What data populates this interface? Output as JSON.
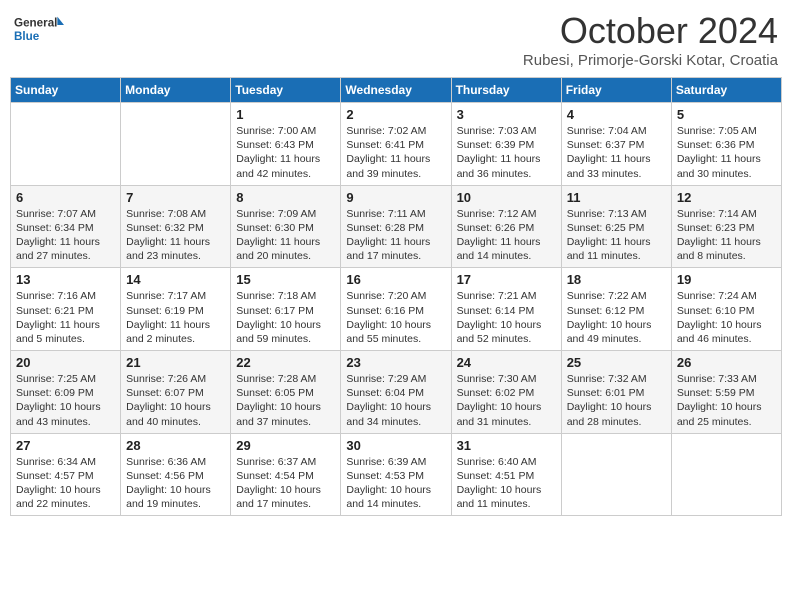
{
  "header": {
    "logo_line1": "General",
    "logo_line2": "Blue",
    "month_title": "October 2024",
    "subtitle": "Rubesi, Primorje-Gorski Kotar, Croatia"
  },
  "weekdays": [
    "Sunday",
    "Monday",
    "Tuesday",
    "Wednesday",
    "Thursday",
    "Friday",
    "Saturday"
  ],
  "weeks": [
    [
      {
        "day": "",
        "sunrise": "",
        "sunset": "",
        "daylight": ""
      },
      {
        "day": "",
        "sunrise": "",
        "sunset": "",
        "daylight": ""
      },
      {
        "day": "1",
        "sunrise": "Sunrise: 7:00 AM",
        "sunset": "Sunset: 6:43 PM",
        "daylight": "Daylight: 11 hours and 42 minutes."
      },
      {
        "day": "2",
        "sunrise": "Sunrise: 7:02 AM",
        "sunset": "Sunset: 6:41 PM",
        "daylight": "Daylight: 11 hours and 39 minutes."
      },
      {
        "day": "3",
        "sunrise": "Sunrise: 7:03 AM",
        "sunset": "Sunset: 6:39 PM",
        "daylight": "Daylight: 11 hours and 36 minutes."
      },
      {
        "day": "4",
        "sunrise": "Sunrise: 7:04 AM",
        "sunset": "Sunset: 6:37 PM",
        "daylight": "Daylight: 11 hours and 33 minutes."
      },
      {
        "day": "5",
        "sunrise": "Sunrise: 7:05 AM",
        "sunset": "Sunset: 6:36 PM",
        "daylight": "Daylight: 11 hours and 30 minutes."
      }
    ],
    [
      {
        "day": "6",
        "sunrise": "Sunrise: 7:07 AM",
        "sunset": "Sunset: 6:34 PM",
        "daylight": "Daylight: 11 hours and 27 minutes."
      },
      {
        "day": "7",
        "sunrise": "Sunrise: 7:08 AM",
        "sunset": "Sunset: 6:32 PM",
        "daylight": "Daylight: 11 hours and 23 minutes."
      },
      {
        "day": "8",
        "sunrise": "Sunrise: 7:09 AM",
        "sunset": "Sunset: 6:30 PM",
        "daylight": "Daylight: 11 hours and 20 minutes."
      },
      {
        "day": "9",
        "sunrise": "Sunrise: 7:11 AM",
        "sunset": "Sunset: 6:28 PM",
        "daylight": "Daylight: 11 hours and 17 minutes."
      },
      {
        "day": "10",
        "sunrise": "Sunrise: 7:12 AM",
        "sunset": "Sunset: 6:26 PM",
        "daylight": "Daylight: 11 hours and 14 minutes."
      },
      {
        "day": "11",
        "sunrise": "Sunrise: 7:13 AM",
        "sunset": "Sunset: 6:25 PM",
        "daylight": "Daylight: 11 hours and 11 minutes."
      },
      {
        "day": "12",
        "sunrise": "Sunrise: 7:14 AM",
        "sunset": "Sunset: 6:23 PM",
        "daylight": "Daylight: 11 hours and 8 minutes."
      }
    ],
    [
      {
        "day": "13",
        "sunrise": "Sunrise: 7:16 AM",
        "sunset": "Sunset: 6:21 PM",
        "daylight": "Daylight: 11 hours and 5 minutes."
      },
      {
        "day": "14",
        "sunrise": "Sunrise: 7:17 AM",
        "sunset": "Sunset: 6:19 PM",
        "daylight": "Daylight: 11 hours and 2 minutes."
      },
      {
        "day": "15",
        "sunrise": "Sunrise: 7:18 AM",
        "sunset": "Sunset: 6:17 PM",
        "daylight": "Daylight: 10 hours and 59 minutes."
      },
      {
        "day": "16",
        "sunrise": "Sunrise: 7:20 AM",
        "sunset": "Sunset: 6:16 PM",
        "daylight": "Daylight: 10 hours and 55 minutes."
      },
      {
        "day": "17",
        "sunrise": "Sunrise: 7:21 AM",
        "sunset": "Sunset: 6:14 PM",
        "daylight": "Daylight: 10 hours and 52 minutes."
      },
      {
        "day": "18",
        "sunrise": "Sunrise: 7:22 AM",
        "sunset": "Sunset: 6:12 PM",
        "daylight": "Daylight: 10 hours and 49 minutes."
      },
      {
        "day": "19",
        "sunrise": "Sunrise: 7:24 AM",
        "sunset": "Sunset: 6:10 PM",
        "daylight": "Daylight: 10 hours and 46 minutes."
      }
    ],
    [
      {
        "day": "20",
        "sunrise": "Sunrise: 7:25 AM",
        "sunset": "Sunset: 6:09 PM",
        "daylight": "Daylight: 10 hours and 43 minutes."
      },
      {
        "day": "21",
        "sunrise": "Sunrise: 7:26 AM",
        "sunset": "Sunset: 6:07 PM",
        "daylight": "Daylight: 10 hours and 40 minutes."
      },
      {
        "day": "22",
        "sunrise": "Sunrise: 7:28 AM",
        "sunset": "Sunset: 6:05 PM",
        "daylight": "Daylight: 10 hours and 37 minutes."
      },
      {
        "day": "23",
        "sunrise": "Sunrise: 7:29 AM",
        "sunset": "Sunset: 6:04 PM",
        "daylight": "Daylight: 10 hours and 34 minutes."
      },
      {
        "day": "24",
        "sunrise": "Sunrise: 7:30 AM",
        "sunset": "Sunset: 6:02 PM",
        "daylight": "Daylight: 10 hours and 31 minutes."
      },
      {
        "day": "25",
        "sunrise": "Sunrise: 7:32 AM",
        "sunset": "Sunset: 6:01 PM",
        "daylight": "Daylight: 10 hours and 28 minutes."
      },
      {
        "day": "26",
        "sunrise": "Sunrise: 7:33 AM",
        "sunset": "Sunset: 5:59 PM",
        "daylight": "Daylight: 10 hours and 25 minutes."
      }
    ],
    [
      {
        "day": "27",
        "sunrise": "Sunrise: 6:34 AM",
        "sunset": "Sunset: 4:57 PM",
        "daylight": "Daylight: 10 hours and 22 minutes."
      },
      {
        "day": "28",
        "sunrise": "Sunrise: 6:36 AM",
        "sunset": "Sunset: 4:56 PM",
        "daylight": "Daylight: 10 hours and 19 minutes."
      },
      {
        "day": "29",
        "sunrise": "Sunrise: 6:37 AM",
        "sunset": "Sunset: 4:54 PM",
        "daylight": "Daylight: 10 hours and 17 minutes."
      },
      {
        "day": "30",
        "sunrise": "Sunrise: 6:39 AM",
        "sunset": "Sunset: 4:53 PM",
        "daylight": "Daylight: 10 hours and 14 minutes."
      },
      {
        "day": "31",
        "sunrise": "Sunrise: 6:40 AM",
        "sunset": "Sunset: 4:51 PM",
        "daylight": "Daylight: 10 hours and 11 minutes."
      },
      {
        "day": "",
        "sunrise": "",
        "sunset": "",
        "daylight": ""
      },
      {
        "day": "",
        "sunrise": "",
        "sunset": "",
        "daylight": ""
      }
    ]
  ]
}
